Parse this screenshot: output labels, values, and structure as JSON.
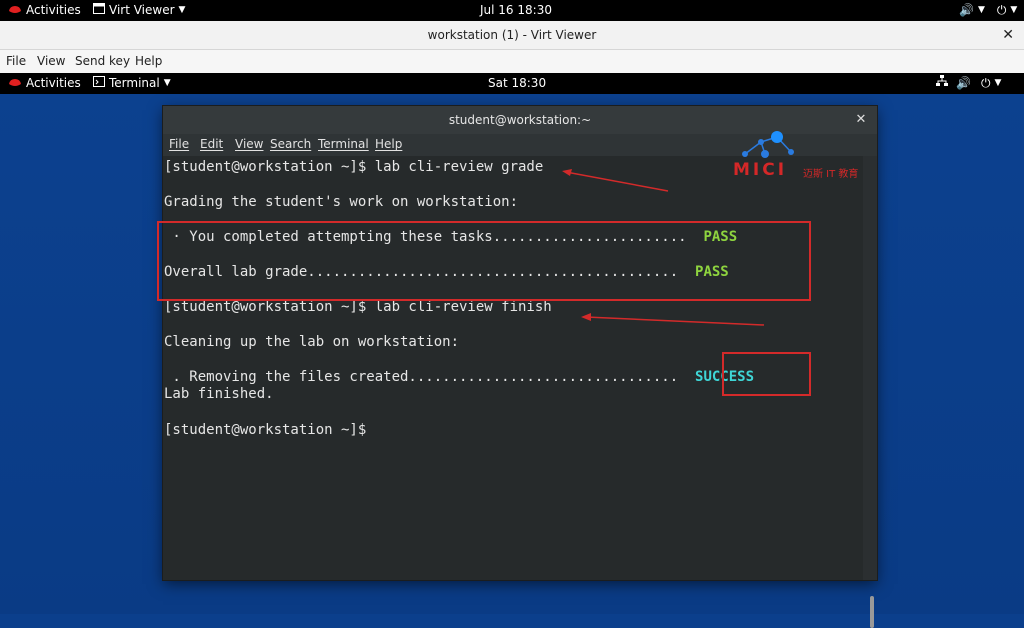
{
  "host_topbar": {
    "activities": "Activities",
    "app_menu": "Virt Viewer",
    "clock": "Jul 16  18:30"
  },
  "viewer": {
    "title": "workstation (1) - Virt Viewer",
    "menu": [
      "File",
      "View",
      "Send key",
      "Help"
    ]
  },
  "guest_topbar": {
    "activities": "Activities",
    "app_menu": "Terminal",
    "clock": "Sat 18:30"
  },
  "terminal": {
    "title": "student@workstation:~",
    "menu": [
      "File",
      "Edit",
      "View",
      "Search",
      "Terminal",
      "Help"
    ],
    "lines": {
      "l1": "[student@workstation ~]$ lab cli-review grade",
      "l2": "Grading the student's work on workstation:",
      "l3_text": " · You completed attempting these tasks.......................  ",
      "l3_status": "PASS",
      "l4_text": "Overall lab grade............................................  ",
      "l4_status": "PASS",
      "l5": "[student@workstation ~]$ lab cli-review finish",
      "l6": "Cleaning up the lab on workstation:",
      "l7_text": " . Removing the files created................................  ",
      "l7_status": "SUCCESS",
      "l8": "Lab finished.",
      "l9": "[student@workstation ~]$"
    }
  },
  "watermark": {
    "brand": "MICI",
    "suffix": "迈斯 IT 教育"
  },
  "colors": {
    "pass": "#8ed43f",
    "success": "#3fd6d6",
    "annotation_red": "#d32a2a",
    "desktop_blue": "#0b3f8c"
  }
}
